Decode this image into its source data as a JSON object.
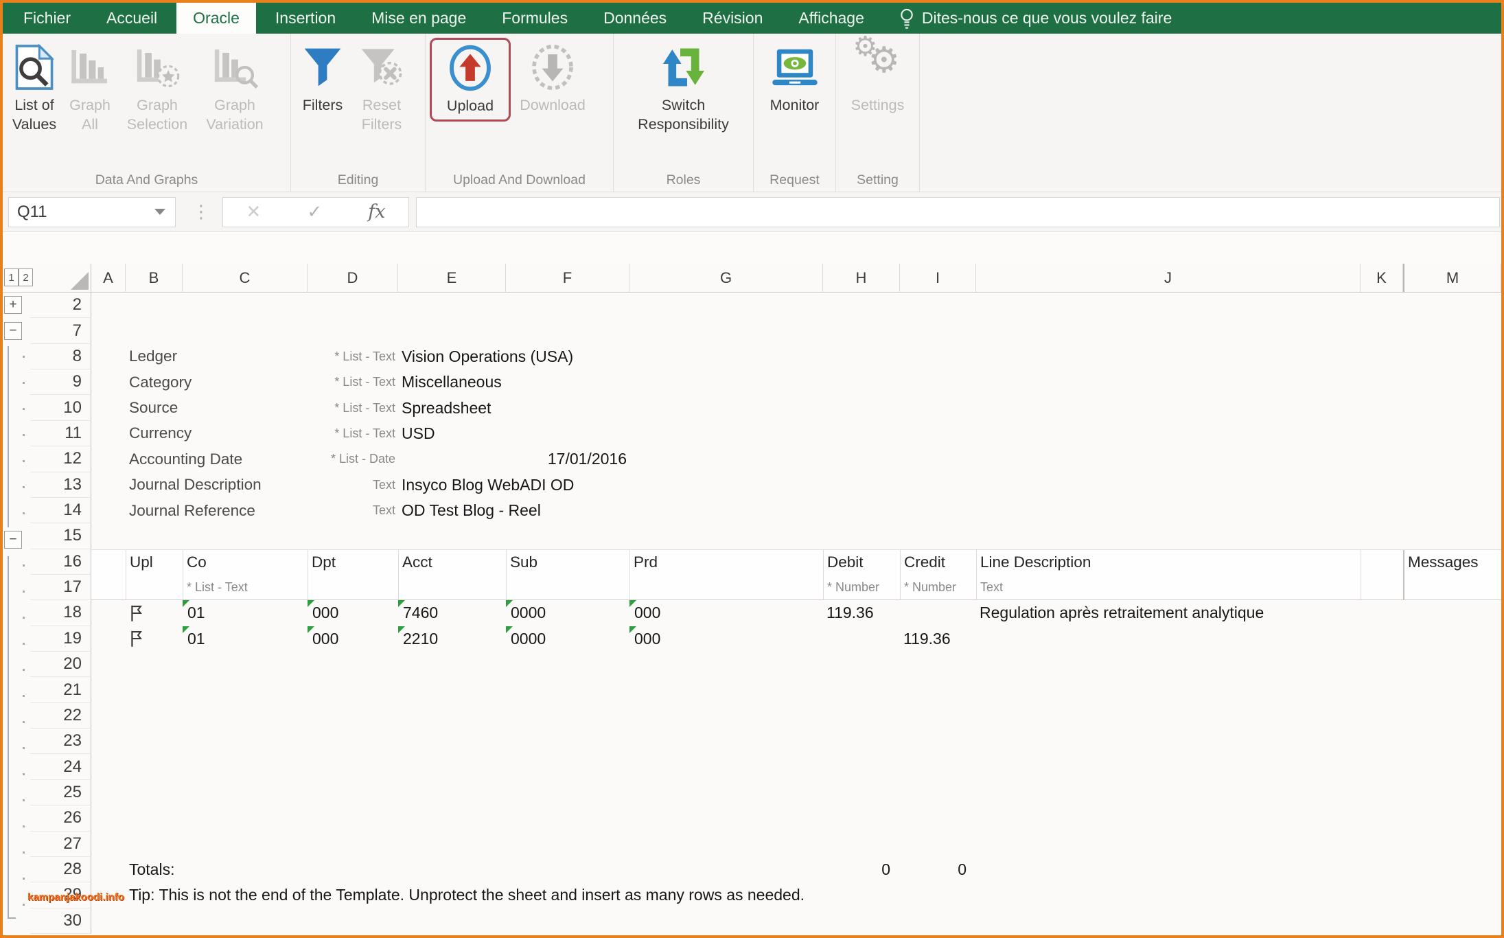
{
  "tabbar": {
    "tabs": [
      "Fichier",
      "Accueil",
      "Oracle",
      "Insertion",
      "Mise en page",
      "Formules",
      "Données",
      "Révision",
      "Affichage"
    ],
    "active_tab": "Oracle",
    "tell_me": "Dites-nous ce que vous voulez faire"
  },
  "ribbon": {
    "groups": [
      {
        "label": "Data And Graphs",
        "buttons": [
          {
            "label": "List of Values",
            "enabled": true
          },
          {
            "label": "Graph All",
            "enabled": false
          },
          {
            "label": "Graph Selection",
            "enabled": false
          },
          {
            "label": "Graph Variation",
            "enabled": false
          }
        ]
      },
      {
        "label": "Editing",
        "buttons": [
          {
            "label": "Filters",
            "enabled": true
          },
          {
            "label": "Reset Filters",
            "enabled": false
          }
        ]
      },
      {
        "label": "Upload And Download",
        "buttons": [
          {
            "label": "Upload",
            "enabled": true,
            "highlighted": true
          },
          {
            "label": "Download",
            "enabled": false
          }
        ]
      },
      {
        "label": "Roles",
        "buttons": [
          {
            "label": "Switch Responsibility",
            "enabled": true
          }
        ]
      },
      {
        "label": "Request",
        "buttons": [
          {
            "label": "Monitor",
            "enabled": true
          }
        ]
      },
      {
        "label": "Setting",
        "buttons": [
          {
            "label": "Settings",
            "enabled": false
          }
        ]
      }
    ]
  },
  "formula": {
    "name_box": "Q11",
    "value": "",
    "fx_label": "fx",
    "cancel_glyph": "✕",
    "enter_glyph": "✓"
  },
  "grid": {
    "columns": [
      "A",
      "B",
      "C",
      "D",
      "E",
      "F",
      "G",
      "H",
      "I",
      "J",
      "K",
      "M"
    ],
    "row_numbers": [
      "2",
      "7",
      "8",
      "9",
      "10",
      "11",
      "12",
      "13",
      "14",
      "15",
      "16",
      "17",
      "18",
      "19",
      "20",
      "21",
      "22",
      "23",
      "24",
      "25",
      "26",
      "27",
      "28",
      "29",
      "30"
    ],
    "outline": {
      "level1": "1",
      "level2": "2",
      "collapse": "−",
      "expand": "+"
    }
  },
  "sheet": {
    "fields": [
      {
        "label": "Ledger",
        "hint": "* List - Text",
        "value": "Vision Operations (USA)"
      },
      {
        "label": "Category",
        "hint": "* List - Text",
        "value": "Miscellaneous"
      },
      {
        "label": "Source",
        "hint": "* List - Text",
        "value": "Spreadsheet"
      },
      {
        "label": "Currency",
        "hint": "* List - Text",
        "value": "USD"
      },
      {
        "label": "Accounting Date",
        "hint": "* List - Date",
        "value": "17/01/2016"
      },
      {
        "label": "Journal Description",
        "hint": "Text",
        "value": "Insyco Blog WebADI OD"
      },
      {
        "label": "Journal Reference",
        "hint": "Text",
        "value": "OD Test Blog - Reel"
      }
    ],
    "table": {
      "headers": [
        "Upl",
        "Co",
        "Dpt",
        "Acct",
        "Sub",
        "Prd",
        "Debit",
        "Credit",
        "Line Description",
        "Messages"
      ],
      "hints": {
        "co": "* List - Text",
        "debit": "* Number",
        "credit": "* Number",
        "line_description": "Text"
      },
      "rows": [
        {
          "co": "01",
          "dpt": "000",
          "acct": "7460",
          "sub": "0000",
          "prd": "000",
          "debit": "119.36",
          "credit": "",
          "line_description": "Regulation après retraitement analytique"
        },
        {
          "co": "01",
          "dpt": "000",
          "acct": "2210",
          "sub": "0000",
          "prd": "000",
          "debit": "",
          "credit": "119.36",
          "line_description": ""
        }
      ],
      "totals": {
        "label": "Totals:",
        "debit": "0",
        "credit": "0"
      },
      "tip": "Tip: This is not the end of the Template.  Unprotect the sheet and insert as many rows as needed."
    }
  },
  "watermark": "kampanjakoodi.info",
  "colors": {
    "excel_green": "#1e6f43",
    "window_border": "#e8811c",
    "upload_highlight": "#b04a56",
    "enabled_blue": "#2e7cc2",
    "marker_green": "#2f9e3f"
  }
}
